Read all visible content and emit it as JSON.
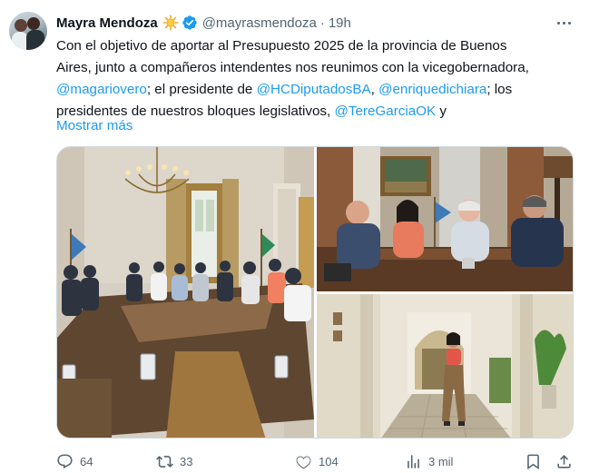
{
  "author": {
    "name": "Mayra Mendoza",
    "handle": "@mayrasmendoza",
    "separator": "·",
    "time": "19h",
    "sun_icon": "sun-emoji",
    "verified_icon": "verified-badge-icon",
    "verified_color": "#1d9bf0"
  },
  "tweet": {
    "line1": "Con el objetivo de aportar al Presupuesto 2025 de la provincia de Buenos",
    "line2": "Aires, junto a compañeros intendentes nos reunimos con la vicegobernadora,",
    "line3_m1": "@magariovero",
    "line3_t1": "; el presidente de ",
    "line3_m2": "@HCDiputadosBA",
    "line3_t2": ", ",
    "line3_m3": "@enriquedichiara",
    "line3_t3": "; los",
    "line4_t1": "presidentes de nuestros bloques legislativos, ",
    "line4_m1": "@TereGarciaOK",
    "line4_t2": " y",
    "show_more": "Mostrar más",
    "link_color": "#1d9bf0"
  },
  "media": {
    "photo_1": "meeting-room-photo",
    "photo_2": "officials-at-table-photo",
    "photo_3": "woman-in-corridor-photo"
  },
  "actions": {
    "replies": "64",
    "reposts": "33",
    "likes": "104",
    "views": "3 mil"
  }
}
